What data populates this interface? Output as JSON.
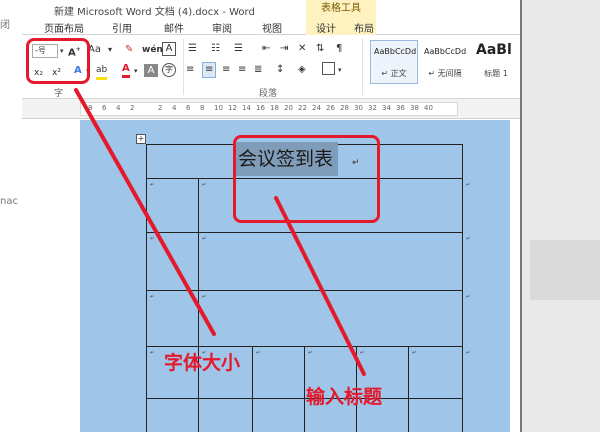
{
  "window": {
    "title": "新建 Microsoft Word 文档 (4).docx - Word"
  },
  "context_header": "表格工具",
  "tabs": [
    "页面布局",
    "引用",
    "邮件",
    "审阅",
    "视图",
    "设计",
    "布局"
  ],
  "ribbon": {
    "font_group_label": "字",
    "paragraph_group_label": "段落",
    "font_size_value": "-号",
    "aa_label": "Aa",
    "style_gallery": [
      {
        "preview": "AaBbCcDd",
        "name": "↵ 正文"
      },
      {
        "preview": "AaBbCcDd",
        "name": "↵ 无间隔"
      },
      {
        "preview": "AaBl",
        "name": "标题 1"
      }
    ]
  },
  "ruler": {
    "numbers": [
      "8",
      "6",
      "4",
      "2",
      "2",
      "4",
      "6",
      "8",
      "10",
      "12",
      "14",
      "16",
      "18",
      "20",
      "22",
      "24",
      "26",
      "28",
      "30",
      "32",
      "34",
      "36",
      "38",
      "40"
    ]
  },
  "document": {
    "table_handle": "+",
    "heading": "会议签到表",
    "heading_mark": "↵"
  },
  "annotations": {
    "font_size_label": "字体大小",
    "title_label": "输入标题"
  },
  "left_fragments": [
    "闭",
    "nac"
  ],
  "colors": {
    "annotation": "#e4192b",
    "table_fill": "#9fc5e8",
    "selection": "#7f9db9",
    "context_tab": "#fdf2c0"
  }
}
